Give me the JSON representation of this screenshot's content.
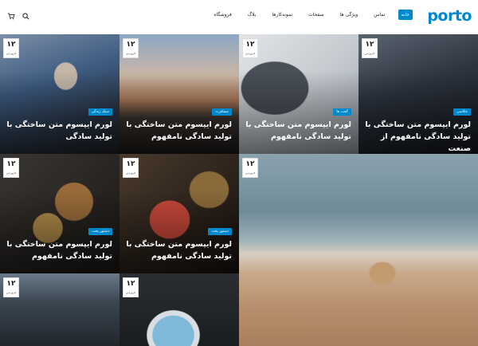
{
  "header": {
    "logo": "porto",
    "nav": [
      {
        "label": "خانه",
        "active": true
      },
      {
        "label": "تماس",
        "active": false
      },
      {
        "label": "ویژگی ها",
        "active": false
      },
      {
        "label": "صفحات",
        "active": false
      },
      {
        "label": "نمونه‌کارها",
        "active": false
      },
      {
        "label": "بلاگ",
        "active": false
      },
      {
        "label": "فروشگاه",
        "active": false
      }
    ],
    "icons": [
      "cart-icon",
      "search-icon"
    ]
  },
  "colors": {
    "accent": "#0088cc"
  },
  "posts": [
    {
      "day": "۱۲",
      "month": "فروردین",
      "category": "سبک زندگی",
      "title": "لورم ایپسوم متن ساختگی با تولید سادگی"
    },
    {
      "day": "۱۲",
      "month": "فروردین",
      "category": "مسافرت",
      "title": "لورم ایپسوم متن ساختگی با تولید سادگی نامفهوم"
    },
    {
      "day": "۱۲",
      "month": "فروردین",
      "category": "گجت ها",
      "title": "لورم ایپسوم متن ساختگی با تولید سادگی نامفهوم"
    },
    {
      "day": "۱۲",
      "month": "فروردین",
      "category": "عکاسی",
      "title": "لورم ایپسوم متن ساختگی با تولید سادگی نامفهوم از صنعت"
    },
    {
      "day": "۱۲",
      "month": "فروردین",
      "category": "دستور پخت",
      "title": "لورم ایپسوم متن ساختگی با تولید سادگی نامفهوم"
    },
    {
      "day": "۱۲",
      "month": "فروردین",
      "category": "دستور پخت",
      "title": "لورم ایپسوم متن ساختگی با تولید سادگی نامفهوم"
    },
    {
      "day": "۱۲",
      "month": "فروردین"
    },
    {
      "day": "۱۲",
      "month": "فروردین"
    },
    {
      "day": "۱۲",
      "month": "فروردین"
    }
  ]
}
